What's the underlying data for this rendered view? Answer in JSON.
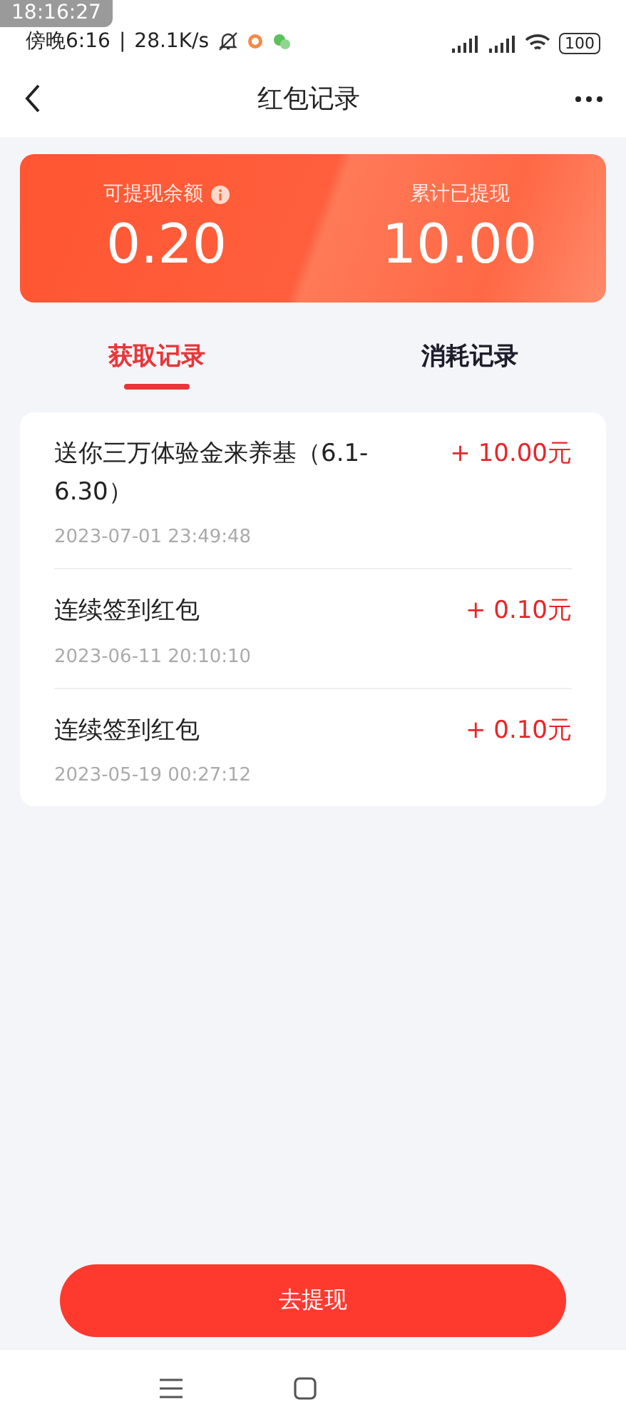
{
  "overlay_clock": "18:16:27",
  "status_bar": {
    "time": "傍晚6:16",
    "separator": "|",
    "speed": "28.1K/s",
    "battery": "100"
  },
  "header": {
    "title": "红包记录"
  },
  "summary": [
    {
      "label": "可提现余额",
      "value": "0.20",
      "info": true
    },
    {
      "label": "累计已提现",
      "value": "10.00",
      "info": false
    }
  ],
  "tabs": [
    {
      "label": "获取记录",
      "selected": true
    },
    {
      "label": "消耗记录",
      "selected": false
    }
  ],
  "records": [
    {
      "title": "送你三万体验金来养基（6.1-6.30）",
      "amount": "+ 10.00元",
      "time": "2023-07-01 23:49:48"
    },
    {
      "title": "连续签到红包",
      "amount": "+ 0.10元",
      "time": "2023-06-11 20:10:10"
    },
    {
      "title": "连续签到红包",
      "amount": "+ 0.10元",
      "time": "2023-05-19 00:27:12"
    }
  ],
  "withdraw_button": "去提现"
}
